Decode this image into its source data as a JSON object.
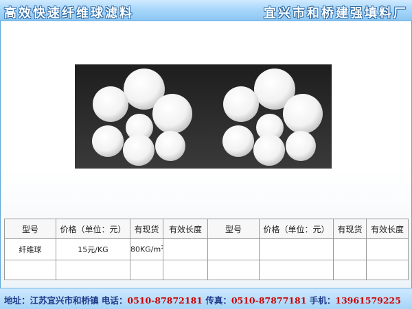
{
  "header": {
    "left_title": "高效快速纤维球滤料",
    "right_title": "宜兴市和桥建强填料厂"
  },
  "colors": {
    "header_bg": "#a9d7fb",
    "title_outline": "#2a6aa6",
    "footer_label": "#1f3a8a",
    "footer_value": "#cc0000",
    "photo_bg": "#2b2b2b"
  },
  "table": {
    "headers": [
      "型号",
      "价格（单位：元）",
      "有现货",
      "有效长度",
      "型号",
      "价格（单位：元）",
      "有现货",
      "有效长度"
    ],
    "rows": [
      [
        "纤维球",
        "15元/KG",
        "80KG/m",
        "",
        "",
        "",
        "",
        ""
      ],
      [
        "",
        "",
        "",
        "",
        "",
        "",
        "",
        ""
      ]
    ],
    "superscript": "3"
  },
  "footer": {
    "address_label": "地址：",
    "address_value": "江苏宜兴市和桥镇",
    "phone_label": "电话：",
    "phone_value": "0510-87872181",
    "fax_label": "传真：",
    "fax_value": "0510-87877181",
    "mobile_label": "手机：",
    "mobile_value": "13961579225"
  }
}
